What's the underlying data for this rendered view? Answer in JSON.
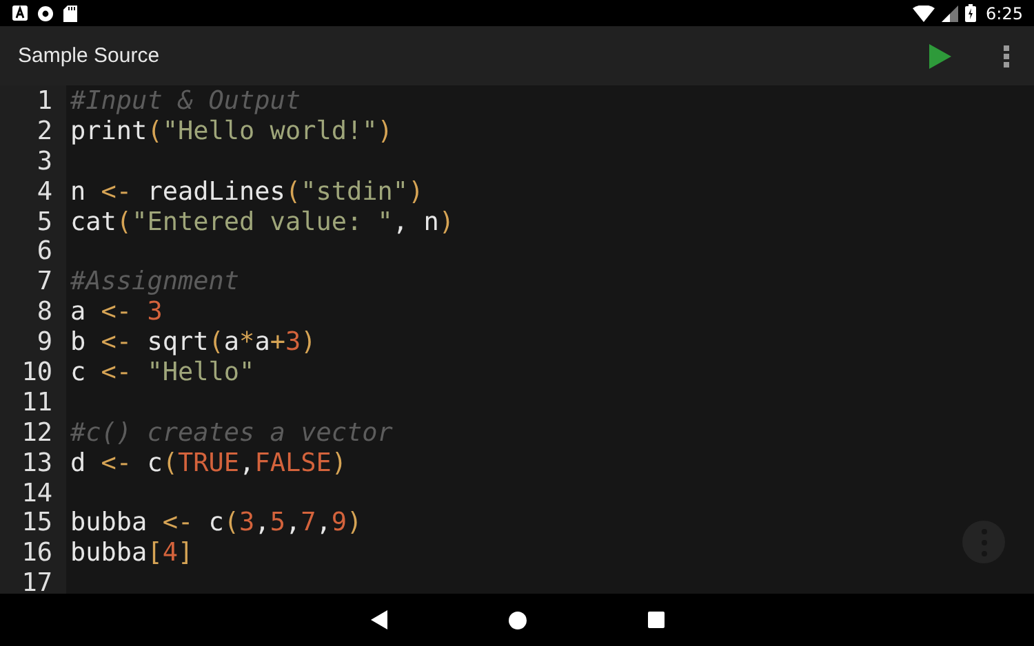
{
  "status_bar": {
    "time": "6:25"
  },
  "toolbar": {
    "title": "Sample Source"
  },
  "editor": {
    "lines": [
      {
        "number": "1",
        "tokens": [
          {
            "text": "#Input & Output",
            "kind": "comment"
          }
        ]
      },
      {
        "number": "2",
        "tokens": [
          {
            "text": "print",
            "kind": "plain"
          },
          {
            "text": "(",
            "kind": "op"
          },
          {
            "text": "\"Hello world!\"",
            "kind": "string"
          },
          {
            "text": ")",
            "kind": "op"
          }
        ]
      },
      {
        "number": "3"
      },
      {
        "number": "4",
        "tokens": [
          {
            "text": "n ",
            "kind": "plain"
          },
          {
            "text": "<-",
            "kind": "op"
          },
          {
            "text": " readLines",
            "kind": "plain"
          },
          {
            "text": "(",
            "kind": "op"
          },
          {
            "text": "\"stdin\"",
            "kind": "string"
          },
          {
            "text": ")",
            "kind": "op"
          }
        ]
      },
      {
        "number": "5",
        "tokens": [
          {
            "text": "cat",
            "kind": "plain"
          },
          {
            "text": "(",
            "kind": "op"
          },
          {
            "text": "\"Entered value: \"",
            "kind": "string"
          },
          {
            "text": ", n",
            "kind": "plain"
          },
          {
            "text": ")",
            "kind": "op"
          }
        ]
      },
      {
        "number": "6"
      },
      {
        "number": "7",
        "tokens": [
          {
            "text": "#Assignment",
            "kind": "comment"
          }
        ]
      },
      {
        "number": "8",
        "tokens": [
          {
            "text": "a ",
            "kind": "plain"
          },
          {
            "text": "<- ",
            "kind": "op"
          },
          {
            "text": "3",
            "kind": "number"
          }
        ]
      },
      {
        "number": "9",
        "tokens": [
          {
            "text": "b ",
            "kind": "plain"
          },
          {
            "text": "<-",
            "kind": "op"
          },
          {
            "text": " sqrt",
            "kind": "plain"
          },
          {
            "text": "(",
            "kind": "op"
          },
          {
            "text": "a",
            "kind": "plain"
          },
          {
            "text": "*",
            "kind": "op"
          },
          {
            "text": "a",
            "kind": "plain"
          },
          {
            "text": "+",
            "kind": "op"
          },
          {
            "text": "3",
            "kind": "number"
          },
          {
            "text": ")",
            "kind": "op"
          }
        ]
      },
      {
        "number": "10",
        "tokens": [
          {
            "text": "c ",
            "kind": "plain"
          },
          {
            "text": "<- ",
            "kind": "op"
          },
          {
            "text": "\"Hello\"",
            "kind": "string"
          }
        ]
      },
      {
        "number": "11"
      },
      {
        "number": "12",
        "tokens": [
          {
            "text": "#c() creates a vector",
            "kind": "comment"
          }
        ]
      },
      {
        "number": "13",
        "tokens": [
          {
            "text": "d ",
            "kind": "plain"
          },
          {
            "text": "<-",
            "kind": "op"
          },
          {
            "text": " c",
            "kind": "plain"
          },
          {
            "text": "(",
            "kind": "op"
          },
          {
            "text": "TRUE",
            "kind": "number"
          },
          {
            "text": ",",
            "kind": "plain"
          },
          {
            "text": "FALSE",
            "kind": "number"
          },
          {
            "text": ")",
            "kind": "op"
          }
        ]
      },
      {
        "number": "14"
      },
      {
        "number": "15",
        "tokens": [
          {
            "text": "bubba ",
            "kind": "plain"
          },
          {
            "text": "<-",
            "kind": "op"
          },
          {
            "text": " c",
            "kind": "plain"
          },
          {
            "text": "(",
            "kind": "op"
          },
          {
            "text": "3",
            "kind": "number"
          },
          {
            "text": ",",
            "kind": "plain"
          },
          {
            "text": "5",
            "kind": "number"
          },
          {
            "text": ",",
            "kind": "plain"
          },
          {
            "text": "7",
            "kind": "number"
          },
          {
            "text": ",",
            "kind": "plain"
          },
          {
            "text": "9",
            "kind": "number"
          },
          {
            "text": ")",
            "kind": "op"
          }
        ]
      },
      {
        "number": "16",
        "tokens": [
          {
            "text": "bubba",
            "kind": "plain"
          },
          {
            "text": "[",
            "kind": "op"
          },
          {
            "text": "4",
            "kind": "number"
          },
          {
            "text": "]",
            "kind": "op"
          }
        ]
      },
      {
        "number": "17"
      }
    ]
  }
}
